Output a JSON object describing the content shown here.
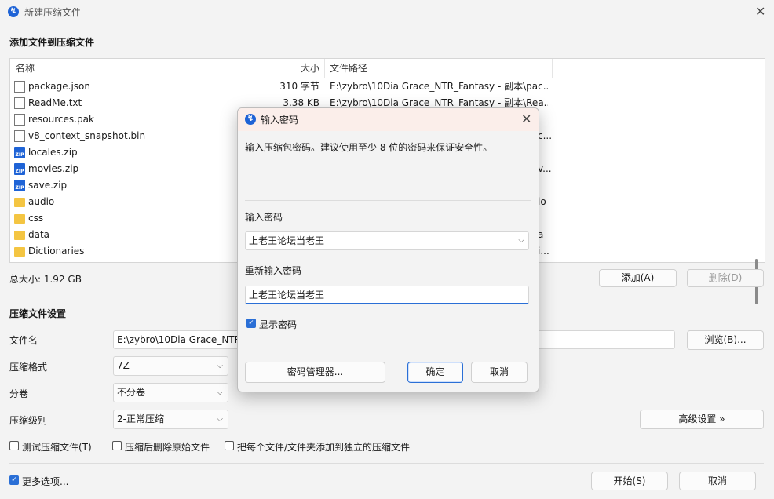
{
  "window": {
    "title": "新建压缩文件"
  },
  "add_section": {
    "title": "添加文件到压缩文件"
  },
  "file_list": {
    "columns": [
      "名称",
      "大小",
      "文件路径"
    ],
    "rows": [
      {
        "name": "package.json",
        "size": "310 字节",
        "path": "E:\\zybro\\10Dia Grace_NTR_Fantasy - 副本\\pac...",
        "icon": "json-file-icon"
      },
      {
        "name": "ReadMe.txt",
        "size": "3.38 KB",
        "path": "E:\\zybro\\10Dia Grace_NTR_Fantasy - 副本\\Rea...",
        "icon": "text-file-icon"
      },
      {
        "name": "resources.pak",
        "size": "",
        "path": "",
        "icon": "file-icon"
      },
      {
        "name": "v8_context_snapshot.bin",
        "size": "",
        "path": "c...",
        "icon": "file-icon"
      },
      {
        "name": "locales.zip",
        "size": "",
        "path": "",
        "icon": "zip-icon"
      },
      {
        "name": "movies.zip",
        "size": "",
        "path": "v...",
        "icon": "zip-icon"
      },
      {
        "name": "save.zip",
        "size": "",
        "path": "",
        "icon": "zip-icon"
      },
      {
        "name": "audio",
        "size": "",
        "path": "io",
        "icon": "folder-icon"
      },
      {
        "name": "css",
        "size": "",
        "path": "",
        "icon": "folder-icon"
      },
      {
        "name": "data",
        "size": "",
        "path": "a",
        "icon": "folder-icon"
      },
      {
        "name": "Dictionaries",
        "size": "",
        "path": "i...",
        "icon": "folder-icon"
      }
    ]
  },
  "total_size": "总大小: 1.92 GB",
  "buttons": {
    "add": "添加(A)",
    "remove": "删除(D)",
    "browse": "浏览(B)...",
    "advanced": "高级设置 »",
    "start": "开始(S)",
    "cancel": "取消"
  },
  "settings": {
    "title": "压缩文件设置",
    "filename_label": "文件名",
    "filename_value": "E:\\zybro\\10Dia Grace_NTR",
    "format_label": "压缩格式",
    "format_value": "7Z",
    "split_label": "分卷",
    "split_value": "不分卷",
    "level_label": "压缩级别",
    "level_value": "2-正常压缩"
  },
  "options": {
    "test": "测试压缩文件(T)",
    "delete_after": "压缩后删除原始文件",
    "each_separate": "把每个文件/文件夹添加到独立的压缩文件",
    "more": "更多选项..."
  },
  "dialog": {
    "title": "输入密码",
    "hint": "输入压缩包密码。建议使用至少 8 位的密码来保证安全性。",
    "password_label": "输入密码",
    "password_value": "上老王论坛当老王",
    "confirm_label": "重新输入密码",
    "confirm_value": "上老王论坛当老王",
    "show_password": "显示密码",
    "manager_button": "密码管理器...",
    "ok_button": "确定",
    "cancel_button": "取消"
  },
  "colors": {
    "accent": "#2a6fd6",
    "folder": "#f4c542",
    "dialog_titlebar": "#fbeeea"
  }
}
